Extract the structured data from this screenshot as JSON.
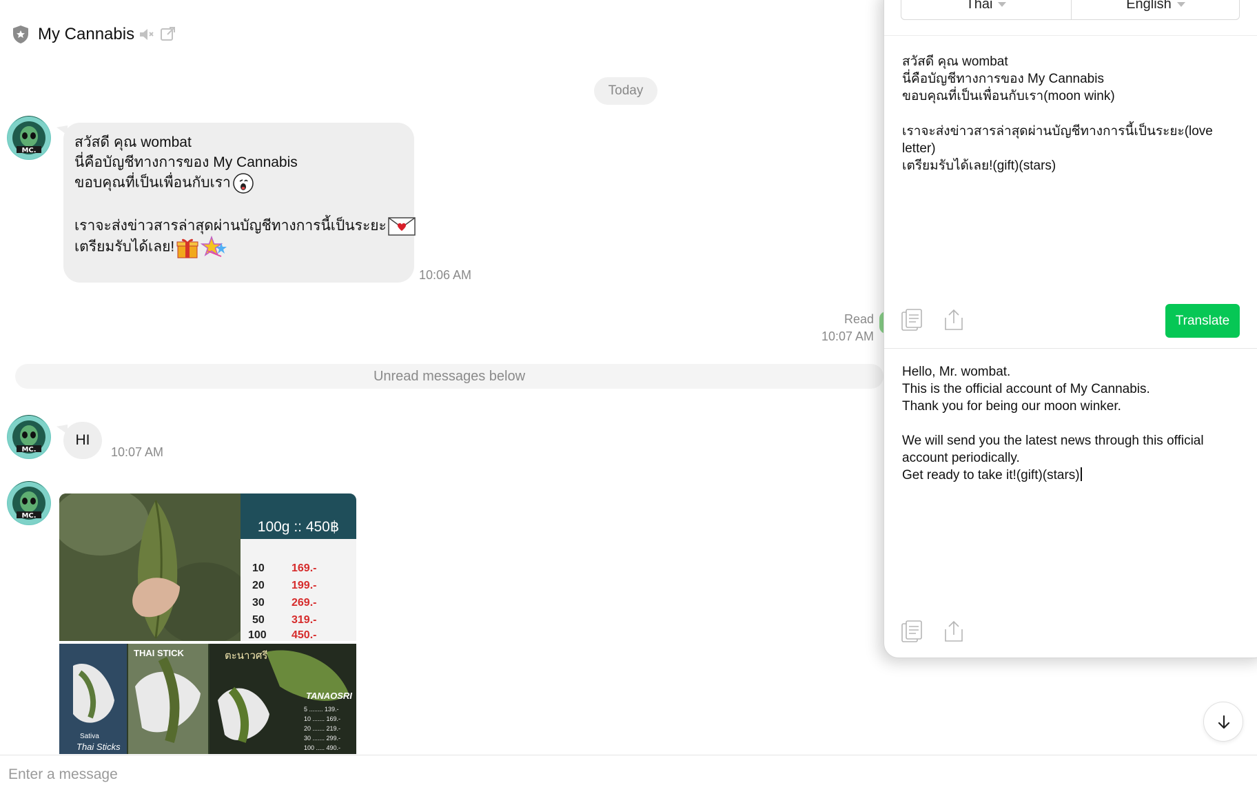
{
  "header": {
    "title": "My Cannabis",
    "icons": [
      "shield-icon",
      "speaker-icon",
      "popout-icon"
    ]
  },
  "chat": {
    "date_label": "Today",
    "messages": [
      {
        "lines": [
          "สวัสดี คุณ wombat",
          "นี่คือบัญชีทางการของ My Cannabis",
          "ขอบคุณที่เป็นเพื่อนกับเรา",
          "",
          "เราจะส่งข่าวสารล่าสุดผ่านบัญชีทางการนี้เป็นระยะ",
          "เตรียมรับได้เลย!"
        ],
        "time": "10:06 AM"
      },
      {
        "text": "HI",
        "time": "10:07 AM"
      }
    ],
    "read_label": "Read",
    "read_time": "10:07 AM",
    "unread_label": "Unread messages below",
    "image": {
      "price_header": "100g :: 450฿",
      "price_rows": [
        {
          "qty": "10",
          "price": "169.-"
        },
        {
          "qty": "20",
          "price": "199.-"
        },
        {
          "qty": "30",
          "price": "269.-"
        },
        {
          "qty": "50",
          "price": "319.-"
        },
        {
          "qty": "100",
          "price": "450.-"
        }
      ],
      "tiles": [
        "THAI STICK",
        "ตะนาวศรี",
        "TANAOSRI",
        "Sativa",
        "Thai Sticks"
      ]
    }
  },
  "composer": {
    "placeholder": "Enter a message"
  },
  "translator": {
    "source_lang": "Thai",
    "target_lang": "English",
    "source_lines": [
      "สวัสดี คุณ wombat",
      "นี่คือบัญชีทางการของ My Cannabis",
      "ขอบคุณที่เป็นเพื่อนกับเรา(moon wink)",
      "",
      "เราจะส่งข่าวสารล่าสุดผ่านบัญชีทางการนี้เป็นระยะ(love",
      "letter)",
      "เตรียมรับได้เลย!(gift)(stars)"
    ],
    "translate_label": "Translate",
    "result_lines": [
      "Hello, Mr. wombat.",
      "This is the official account of My Cannabis.",
      "Thank you for being our moon winker.",
      "",
      "We will send you the latest news through this official",
      "account periodically.",
      "Get ready to take it!(gift)(stars)"
    ],
    "accent_color": "#06c755"
  }
}
